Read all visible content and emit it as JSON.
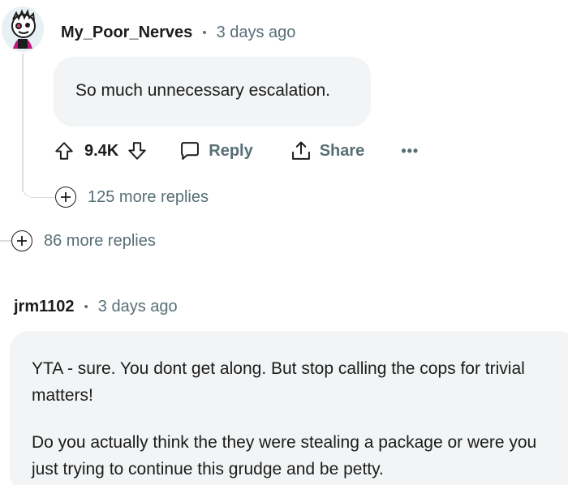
{
  "comment1": {
    "username": "My_Poor_Nerves",
    "separator": "•",
    "time": "3 days ago",
    "body": "So much unnecessary escalation.",
    "upvotes": "9.4K",
    "reply_label": "Reply",
    "share_label": "Share",
    "more_label": "•••",
    "more_replies": "125 more replies"
  },
  "thread": {
    "more_replies": "86 more replies"
  },
  "comment2": {
    "username": "jrm1102",
    "separator": "•",
    "time": "3 days ago",
    "paragraphs": [
      "YTA - sure. You dont get along. But stop calling the cops for trivial matters!",
      "Do you actually think the they were stealing a package or were you just trying to continue this grudge and be petty."
    ]
  },
  "colors": {
    "text": "#1c1c1c",
    "muted": "#576f76",
    "bubble": "#f2f4f5",
    "thread_line": "#dcdcdc"
  },
  "icons": [
    "upvote-icon",
    "downvote-icon",
    "comment-icon",
    "share-icon",
    "plus-circle-icon"
  ]
}
